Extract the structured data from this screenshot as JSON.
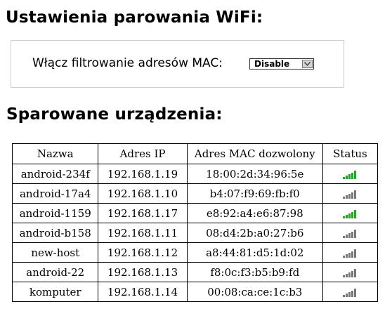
{
  "wifi_section": {
    "title": "Ustawienia parowania WiFi:",
    "mac_filter": {
      "label": "Włącz filtrowanie adresów MAC:",
      "selected": "Disable"
    }
  },
  "paired_section": {
    "title": "Sparowane urządzenia:",
    "columns": [
      "Nazwa",
      "Adres IP",
      "Adres MAC dozwolony",
      "Status"
    ],
    "rows": [
      {
        "name": "android-234f",
        "ip": "192.168.1.19",
        "mac": "18:00:2d:34:96:5e",
        "status": "connected"
      },
      {
        "name": "android-17a4",
        "ip": "192.168.1.10",
        "mac": "b4:07:f9:69:fb:f0",
        "status": "disconnected"
      },
      {
        "name": "android-1159",
        "ip": "192.168.1.17",
        "mac": "e8:92:a4:e6:87:98",
        "status": "connected"
      },
      {
        "name": "android-b158",
        "ip": "192.168.1.11",
        "mac": "08:d4:2b:a0:27:b6",
        "status": "disconnected"
      },
      {
        "name": "new-host",
        "ip": "192.168.1.12",
        "mac": "a8:44:81:d5:1d:02",
        "status": "disconnected"
      },
      {
        "name": "android-22",
        "ip": "192.168.1.13",
        "mac": "f8:0c:f3:b5:b9:fd",
        "status": "disconnected"
      },
      {
        "name": "komputer",
        "ip": "192.168.1.14",
        "mac": "00:08:ca:ce:1c:b3",
        "status": "disconnected"
      }
    ]
  },
  "colors": {
    "signal_connected": "#2e9e2e",
    "signal_disconnected": "#777777"
  },
  "icons": {
    "status": "signal-bars-icon",
    "select_arrow": "chevron-down-icon"
  }
}
